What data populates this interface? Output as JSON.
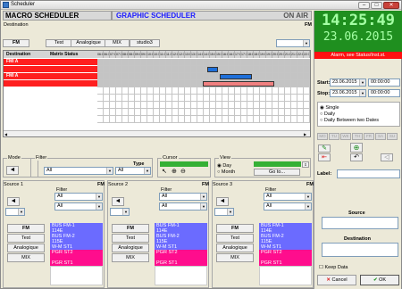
{
  "window": {
    "title": "Scheduler"
  },
  "header": {
    "macro": "MACRO SCHEDULER",
    "graphic": "GRAPHIC SCHEDULER",
    "onair": "ON AIR"
  },
  "destination": {
    "label": "Destination",
    "fm_label": "FM",
    "tabs": [
      "FM",
      "Test",
      "Analogique",
      "MIX",
      "studio3"
    ]
  },
  "grid": {
    "col_destination": "Destination",
    "col_matrix": "Matrix Status",
    "rows": [
      {
        "name": "FMI A",
        "status": ""
      },
      {
        "name": "",
        "status": ""
      },
      {
        "name": "FMI A",
        "status": ""
      },
      {
        "name": "",
        "status": ""
      }
    ],
    "times": [
      "06:00",
      "06:30",
      "07:00",
      "07:30",
      "08:00",
      "08:30",
      "09:00",
      "09:30",
      "10:00",
      "10:30",
      "11:00",
      "11:30",
      "12:00",
      "12:30",
      "13:00",
      "13:30",
      "14:00",
      "14:30",
      "15:00",
      "15:30",
      "16:00",
      "16:30",
      "17:00",
      "17:30",
      "18:00",
      "18:30",
      "19:00",
      "19:30",
      "20:00",
      "20:30",
      "21:00",
      "21:30",
      "22:00",
      "22:30"
    ],
    "events": [
      {
        "row": 1,
        "start": 0.518,
        "end": 0.567,
        "color": "#1e6fd9"
      },
      {
        "row": 2,
        "start": 0.576,
        "end": 0.728,
        "color": "#1e6fd9"
      },
      {
        "row": 3,
        "start": 0.494,
        "end": 0.831,
        "color": "#f08080"
      }
    ]
  },
  "bottombar": {
    "mode": "Mode",
    "filter": "Filter",
    "type": "Type",
    "type_value": "All",
    "filter_value": "All",
    "cursor": "Cursor",
    "view": "View",
    "day": "Day",
    "month": "Month",
    "goto": "Go to..."
  },
  "sources": [
    {
      "title": "Source 1",
      "fm": "FM",
      "buttons": [
        "FM",
        "Test",
        "Analogique",
        "MIX"
      ],
      "filter_label": "Filter",
      "filter1": "All",
      "filter2": "All",
      "items": [
        {
          "t": "BUS FM-1",
          "c": "blue"
        },
        {
          "t": "114E",
          "c": "blue"
        },
        {
          "t": "BUS FM-2",
          "c": "blue"
        },
        {
          "t": "115E",
          "c": "blue"
        },
        {
          "t": "W-M ST1",
          "c": "blue"
        },
        {
          "t": "PGR ST2",
          "c": "mag"
        },
        {
          "t": "",
          "c": "mag"
        },
        {
          "t": "PGR ST1",
          "c": "mag"
        }
      ]
    },
    {
      "title": "Source 2",
      "fm": "FM",
      "buttons": [
        "FM",
        "Test",
        "Analogique",
        "MIX"
      ],
      "filter_label": "Filter",
      "filter1": "All",
      "filter2": "All",
      "items": [
        {
          "t": "BUS FM-1",
          "c": "blue"
        },
        {
          "t": "114E",
          "c": "blue"
        },
        {
          "t": "BUS FM-2",
          "c": "blue"
        },
        {
          "t": "115E",
          "c": "blue"
        },
        {
          "t": "W-M ST1",
          "c": "blue"
        },
        {
          "t": "PGR ST2",
          "c": "mag"
        },
        {
          "t": "",
          "c": "mag"
        },
        {
          "t": "PGR ST1",
          "c": "mag"
        }
      ]
    },
    {
      "title": "Source 3",
      "fm": "FM",
      "buttons": [
        "FM",
        "Test",
        "Analogique",
        "MIX"
      ],
      "filter_label": "Filter",
      "filter1": "All",
      "filter2": "All",
      "items": [
        {
          "t": "BUS FM-1",
          "c": "blue"
        },
        {
          "t": "114E",
          "c": "blue"
        },
        {
          "t": "BUS FM-2",
          "c": "blue"
        },
        {
          "t": "115E",
          "c": "blue"
        },
        {
          "t": "W-M ST1",
          "c": "blue"
        },
        {
          "t": "PGR ST2",
          "c": "mag"
        },
        {
          "t": "",
          "c": "mag"
        },
        {
          "t": "PGR ST1",
          "c": "mag"
        }
      ]
    }
  ],
  "right": {
    "time": "14:25:49",
    "date": "23.06.2015",
    "alarm": "Alarm, see Status/Inst.st.",
    "start_label": "Start:",
    "start_date": "23.06.2015",
    "start_time": "00:00:00",
    "stop_label": "Stop:",
    "stop_date": "23.06.2015",
    "stop_time": "00:00:00",
    "repeat": [
      "Single",
      "Daily",
      "Daily Between two Dates"
    ],
    "days": [
      "MO",
      "TU",
      "WE",
      "TH",
      "FR",
      "SA",
      "SU"
    ],
    "label": "Label:",
    "source": "Source",
    "destination": "Destination",
    "keep": "Keep Data",
    "cancel": "Cancel",
    "ok": "OK"
  }
}
